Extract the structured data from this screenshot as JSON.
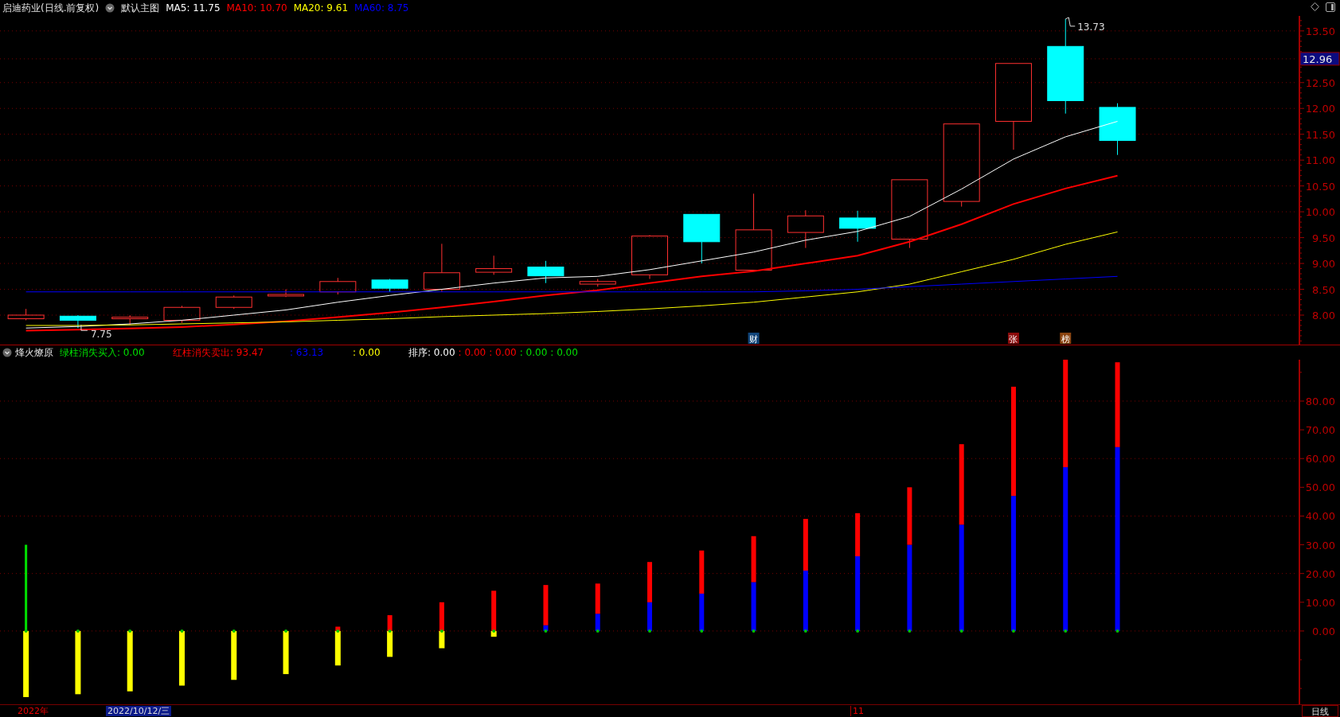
{
  "header": {
    "title": "启迪药业(日线.前复权)",
    "template": "默认主图",
    "ma_values": [
      {
        "label": "MA5: 11.75",
        "color": "#ffffff"
      },
      {
        "label": "MA10: 10.70",
        "color": "#ff0000"
      },
      {
        "label": "MA20: 9.61",
        "color": "#ffff00"
      },
      {
        "label": "MA60: 8.75",
        "color": "#0000ff"
      }
    ]
  },
  "price_panel": {
    "current_price": "12.96",
    "high_label": "13.73",
    "low_label": "7.75",
    "badges": [
      {
        "label": "财",
        "color": "#10457a"
      },
      {
        "label": "张",
        "color": "#8a0b0b"
      },
      {
        "label": "榜",
        "color": "#8a4410"
      }
    ],
    "chart_data": {
      "type": "line",
      "ylim": [
        7.43,
        13.79
      ],
      "grid": true,
      "yticks": [
        {
          "value": 13.5,
          "label": "13.50"
        },
        {
          "value": 12.5,
          "label": "12.50"
        },
        {
          "value": 12,
          "label": "12.00"
        },
        {
          "value": 11.5,
          "label": "11.50"
        },
        {
          "value": 11,
          "label": "11.00"
        },
        {
          "value": 10.5,
          "label": "10.50"
        },
        {
          "value": 10,
          "label": "10.00"
        },
        {
          "value": 9.5,
          "label": "9.50"
        },
        {
          "value": 9,
          "label": "9.00"
        },
        {
          "value": 8.5,
          "label": "8.50"
        },
        {
          "value": 8,
          "label": "8.00"
        }
      ],
      "series": [
        {
          "color": "#ffffff",
          "values": [
            7.75,
            7.78,
            7.83,
            7.9,
            8.0,
            8.1,
            8.25,
            8.38,
            8.5,
            8.62,
            8.72,
            8.75,
            8.88,
            9.05,
            9.22,
            9.45,
            9.62,
            9.91,
            10.44,
            11.02,
            11.45,
            11.75
          ]
        },
        {
          "color": "#ff0000",
          "values": [
            7.7,
            7.72,
            7.74,
            7.77,
            7.82,
            7.88,
            7.96,
            8.05,
            8.15,
            8.26,
            8.38,
            8.48,
            8.62,
            8.75,
            8.85,
            9.0,
            9.15,
            9.42,
            9.76,
            10.15,
            10.45,
            10.7
          ]
        },
        {
          "color": "#ffff00",
          "values": [
            7.8,
            7.8,
            7.81,
            7.83,
            7.85,
            7.87,
            7.9,
            7.93,
            7.97,
            8.0,
            8.03,
            8.07,
            8.12,
            8.18,
            8.25,
            8.35,
            8.45,
            8.6,
            8.84,
            9.08,
            9.37,
            9.61
          ]
        },
        {
          "color": "#0000ff",
          "values": [
            8.45,
            8.45,
            8.45,
            8.45,
            8.45,
            8.45,
            8.45,
            8.45,
            8.45,
            8.45,
            8.45,
            8.45,
            8.45,
            8.45,
            8.45,
            8.47,
            8.5,
            8.55,
            8.6,
            8.65,
            8.7,
            8.75
          ]
        }
      ]
    }
  },
  "indicator": {
    "name": "烽火燎原",
    "values": [
      {
        "label": "绿柱消失买入: 0.00",
        "color": "#00e000"
      },
      {
        "label": "红柱消失卖出: 93.47",
        "color": "#ff0000"
      },
      {
        "label": ": 63.13",
        "color": "#0000ff"
      },
      {
        "label": ": 0.00",
        "color": "#ffff00"
      },
      {
        "label": "排序: 0.00",
        "color": "#ffffff"
      },
      {
        "label": ": 0.00",
        "color": "#ff0000"
      },
      {
        "label": ": 0.00",
        "color": "#ff0000"
      },
      {
        "label": ": 0.00",
        "color": "#00e000"
      },
      {
        "label": ": 0.00",
        "color": "#00e000"
      }
    ],
    "chart_data": {
      "type": "bar",
      "stacked": true,
      "grid": true,
      "ylim": [
        -25.5,
        94.4
      ],
      "yticks": [
        {
          "value": 0,
          "label": "0.00"
        },
        {
          "value": 10,
          "label": "10.00"
        },
        {
          "value": 20,
          "label": "20.00"
        },
        {
          "value": 30,
          "label": "30.00"
        },
        {
          "value": 40,
          "label": "40.00"
        },
        {
          "value": 50,
          "label": "50.00"
        },
        {
          "value": 60,
          "label": "60.00"
        },
        {
          "value": 70,
          "label": "70.00"
        },
        {
          "value": 80,
          "label": "80.00"
        }
      ],
      "series": [
        {
          "color": "#0000ff",
          "values": [
            null,
            null,
            null,
            null,
            null,
            null,
            null,
            null,
            null,
            null,
            2,
            6,
            10,
            13,
            17,
            21,
            26,
            30,
            37,
            47,
            57,
            64,
            null,
            null,
            null
          ]
        },
        {
          "color": "#ff0000",
          "values": [
            null,
            null,
            null,
            null,
            null,
            null,
            1.5,
            5.5,
            10,
            14,
            14,
            10.5,
            14,
            15,
            16,
            18,
            15,
            20,
            28,
            38,
            37.4,
            29.5,
            null,
            null,
            null
          ]
        },
        {
          "color": "#ffff00",
          "values": [
            -23,
            -22,
            -21,
            -19,
            -17,
            -15,
            -12,
            -9,
            -6,
            -2,
            null,
            null,
            null,
            null,
            null,
            null,
            null,
            null,
            null,
            null,
            null,
            null,
            null,
            null,
            null
          ]
        },
        {
          "color": "#00e000",
          "values": [
            30,
            null,
            null,
            null,
            null,
            null,
            null,
            null,
            null,
            null,
            null,
            null,
            null,
            null,
            null,
            null,
            null,
            null,
            null,
            null,
            null,
            null,
            null,
            null,
            null
          ]
        }
      ]
    }
  },
  "time_axis": [
    {
      "kind": "year",
      "label": "2022年"
    },
    {
      "kind": "cursor",
      "label": "2022/10/12/三"
    },
    {
      "kind": "month",
      "label": "11"
    }
  ],
  "period": "日线"
}
